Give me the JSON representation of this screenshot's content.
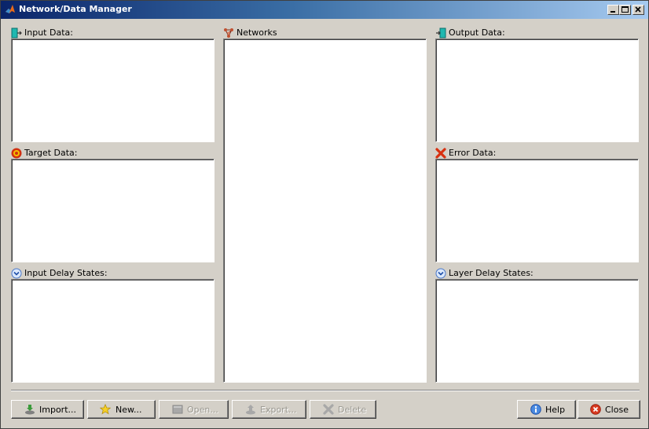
{
  "window": {
    "title": "Network/Data Manager",
    "controls": [
      "minimize-icon",
      "maximize-icon",
      "close-icon"
    ]
  },
  "panels": {
    "input_data": {
      "label": "Input Data:",
      "icon": "input-data-icon"
    },
    "target_data": {
      "label": "Target Data:",
      "icon": "target-icon"
    },
    "input_delay_states": {
      "label": "Input Delay States:",
      "icon": "chevron-down-circle-icon"
    },
    "networks": {
      "label": "Networks",
      "icon": "network-icon"
    },
    "output_data": {
      "label": "Output Data:",
      "icon": "output-data-icon"
    },
    "error_data": {
      "label": "Error Data:",
      "icon": "error-x-icon"
    },
    "layer_delay_states": {
      "label": "Layer Delay States:",
      "icon": "chevron-down-circle-icon"
    }
  },
  "buttons": {
    "import": {
      "label": "Import...",
      "icon": "import-icon",
      "enabled": true
    },
    "new": {
      "label": "New...",
      "icon": "star-icon",
      "enabled": true
    },
    "open": {
      "label": "Open...",
      "icon": "open-icon",
      "enabled": false
    },
    "export": {
      "label": "Export...",
      "icon": "export-icon",
      "enabled": false
    },
    "delete": {
      "label": "Delete",
      "icon": "delete-x-icon",
      "enabled": false
    },
    "help": {
      "label": "Help",
      "icon": "info-icon",
      "enabled": true
    },
    "close": {
      "label": "Close",
      "icon": "close-circle-icon",
      "enabled": true
    }
  },
  "colors": {
    "title_bar_start": "#0a246a",
    "title_bar_end": "#a6caf0",
    "window_background": "#d4d0c8",
    "list_background": "#ffffff"
  }
}
